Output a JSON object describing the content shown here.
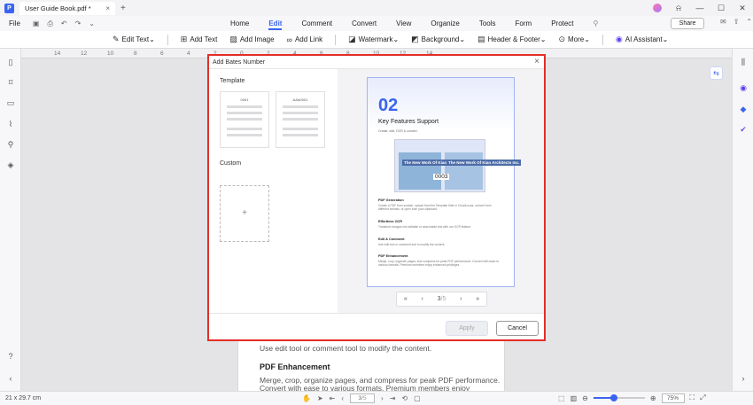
{
  "window": {
    "tab_title": "User Guide Book.pdf *",
    "tab_close": "×",
    "new_tab": "+",
    "minimize": "—",
    "maximize": "☐",
    "close": "✕"
  },
  "menubar": {
    "file": "File",
    "share": "Share"
  },
  "nav_tabs": [
    "Home",
    "Edit",
    "Comment",
    "Convert",
    "View",
    "Organize",
    "Tools",
    "Form",
    "Protect"
  ],
  "active_tab": "Edit",
  "toolbar": {
    "edit_text": "Edit Text",
    "add_text": "Add Text",
    "add_image": "Add Image",
    "add_link": "Add Link",
    "watermark": "Watermark",
    "background": "Background",
    "header_footer": "Header & Footer",
    "more": "More",
    "ai_assistant": "AI Assistant"
  },
  "ruler_ticks": [
    "14",
    "12",
    "10",
    "8",
    "6",
    "4",
    "2",
    "0",
    "2",
    "4",
    "6",
    "8",
    "10",
    "12",
    "14"
  ],
  "page": {
    "line1": "Use edit tool or comment tool to modify the content.",
    "heading": "PDF Enhancement",
    "line2": "Merge, crop, organize pages, and compress for peak PDF performance.",
    "line3": "Convert with ease to various formats. Premium members enjoy enhanced"
  },
  "dialog": {
    "title": "Add Bates Number",
    "close": "×",
    "template_label": "Template",
    "template_cards": [
      "0001",
      "AAA0001"
    ],
    "custom_label": "Custom",
    "custom_add": "+",
    "apply": "Apply",
    "cancel": "Cancel",
    "preview": {
      "number": "02",
      "title": "Key Features Support",
      "subtitle": "Create, edit, OCR & convert.",
      "img_caption": "The New Work Of Kian Architects Inc.",
      "bates": "0003",
      "sections": [
        {
          "head": "PDF Generation",
          "body": "Create a PDF from scratch, upload from the Template Mall or CloudLucas, convert from different formats, or open from your clipboard."
        },
        {
          "head": "Effortless OCR",
          "body": "Transform images into editable or searchable text with our OCR feature."
        },
        {
          "head": "Edit & Comment",
          "body": "Use edit tool or comment tool to modify the content."
        },
        {
          "head": "PDF Enhancement",
          "body": "Merge, crop, organize pages, and compress for peak PDF performance. Convert with ease to various formats. Premium members enjoy enhanced privileges."
        }
      ],
      "pager": {
        "first": "«",
        "prev": "‹",
        "current": "3",
        "total": "/5",
        "next": "›",
        "last": "»"
      }
    }
  },
  "statusbar": {
    "dimensions": "21 x 29.7 cm",
    "page_current": "3",
    "page_total": "/5",
    "zoom": "75%",
    "zoom_fraction": 0.4
  },
  "colors": {
    "accent": "#3a64f0",
    "highlight": "#e52d27"
  }
}
